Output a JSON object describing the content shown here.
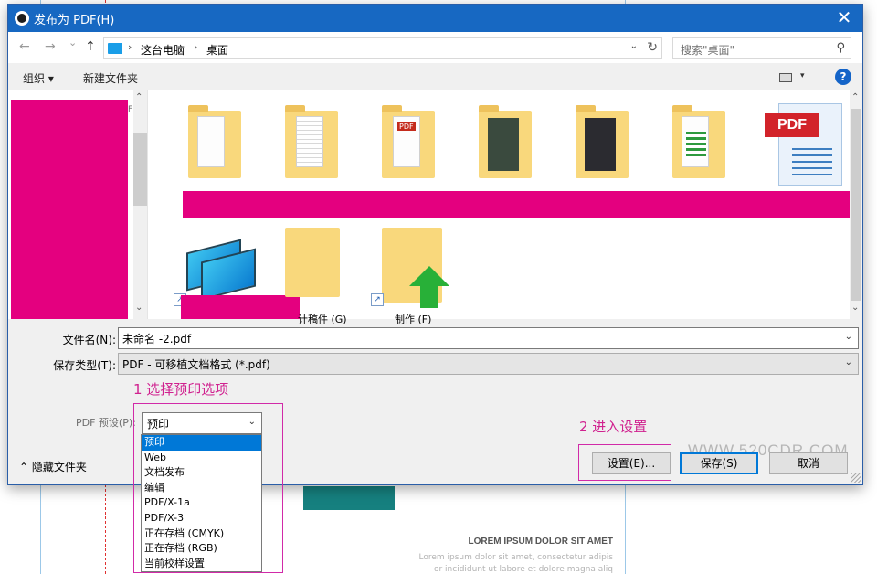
{
  "window": {
    "title": "发布为 PDF(H)",
    "close_glyph": "✕"
  },
  "nav": {
    "back_glyph": "←",
    "forward_glyph": "→",
    "history_glyph": "⌄",
    "up_glyph": "↑",
    "breadcrumb": [
      "这台电脑",
      "桌面"
    ],
    "separator": "›",
    "search_placeholder": "搜索\"桌面\"",
    "dropdown_glyph": "⌄",
    "refresh_glyph": "↻",
    "search_glyph": "⚲"
  },
  "toolbar": {
    "organize_label": "组织 ▾",
    "new_folder_label": "新建文件夹",
    "view_dropdown_glyph": "▾",
    "help_glyph": "?"
  },
  "left_pane": {
    "stub_text": "F",
    "scroll_up": "⌃",
    "scroll_down": "⌄"
  },
  "files": {
    "pdf_label": "PDF",
    "items": [
      {
        "label": "计稿件 (G)"
      },
      {
        "label": "制作 (F)"
      }
    ],
    "shortcut_glyph": "↗"
  },
  "form": {
    "filename_label": "文件名(N):",
    "filename_value": "未命名 -2.pdf",
    "filetype_label": "保存类型(T):",
    "filetype_value": "PDF - 可移植文档格式 (*.pdf)",
    "preset_label": "PDF 预设(P):",
    "preset_value": "预印",
    "dropdown_glyph": "⌄"
  },
  "preset_options": [
    "预印",
    "Web",
    "文档发布",
    "编辑",
    "PDF/X-1a",
    "PDF/X-3",
    "正在存档 (CMYK)",
    "正在存档 (RGB)",
    "当前校样设置"
  ],
  "footer": {
    "hide_folders_label": "⌃ 隐藏文件夹",
    "settings_button": "设置(E)...",
    "save_button": "保存(S)",
    "cancel_button": "取消"
  },
  "annotations": {
    "step1": "1 选择预印选项",
    "step2": "2 进入设置"
  },
  "watermark": "WWW.520CDR.COM",
  "background_doc": {
    "heading": "LOREM IPSUM DOLOR SIT AMET",
    "body_line1": "Lorem ipsum dolor sit amet, consectetur adipis",
    "body_line2": "or incididunt ut labore et dolore magna aliq"
  },
  "colors": {
    "titlebar": "#1768c2",
    "accent": "#0078d7",
    "annotation": "#d0218f",
    "redaction": "#e4007f"
  }
}
